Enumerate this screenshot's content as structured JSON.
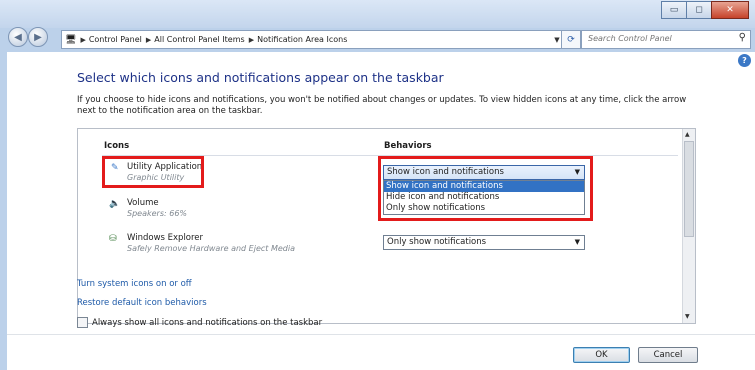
{
  "window": {
    "controls": {
      "minimize": "▭",
      "maximize": "◻",
      "close": "✕"
    }
  },
  "address_bar": {
    "breadcrumbs": [
      "Control Panel",
      "All Control Panel Items",
      "Notification Area Icons"
    ],
    "search_placeholder": "Search Control Panel"
  },
  "icons": {
    "back": "back-arrow-icon",
    "forward": "forward-arrow-icon",
    "refresh": "refresh-icon",
    "search": "search-icon",
    "help": "help-icon"
  },
  "page": {
    "heading": "Select which icons and notifications appear on the taskbar",
    "description": "If you choose to hide icons and notifications, you won't be notified about changes or updates. To view hidden icons at any time, click the arrow next to the notification area on the taskbar.",
    "columns": {
      "icons": "Icons",
      "behaviors": "Behaviors"
    },
    "rows": [
      {
        "name": "Utility Application",
        "subtitle": "Graphic Utility",
        "behavior": "Show icon and notifications"
      },
      {
        "name": "Volume",
        "subtitle": "Speakers: 66%",
        "behavior": ""
      },
      {
        "name": "Windows Explorer",
        "subtitle": "Safely Remove Hardware and Eject Media",
        "behavior": "Only show notifications"
      }
    ],
    "dropdown_options": [
      "Show icon and notifications",
      "Hide icon and notifications",
      "Only show notifications"
    ],
    "links": {
      "system_icons": "Turn system icons on or off",
      "restore": "Restore default icon behaviors"
    },
    "always_show_label": "Always show all icons and notifications on the taskbar",
    "always_show_checked": false,
    "buttons": {
      "ok": "OK",
      "cancel": "Cancel"
    }
  },
  "colors": {
    "highlight_box": "#e31b1b",
    "selection": "#3272c4",
    "heading": "#1e3287",
    "link": "#1e5aa8"
  }
}
